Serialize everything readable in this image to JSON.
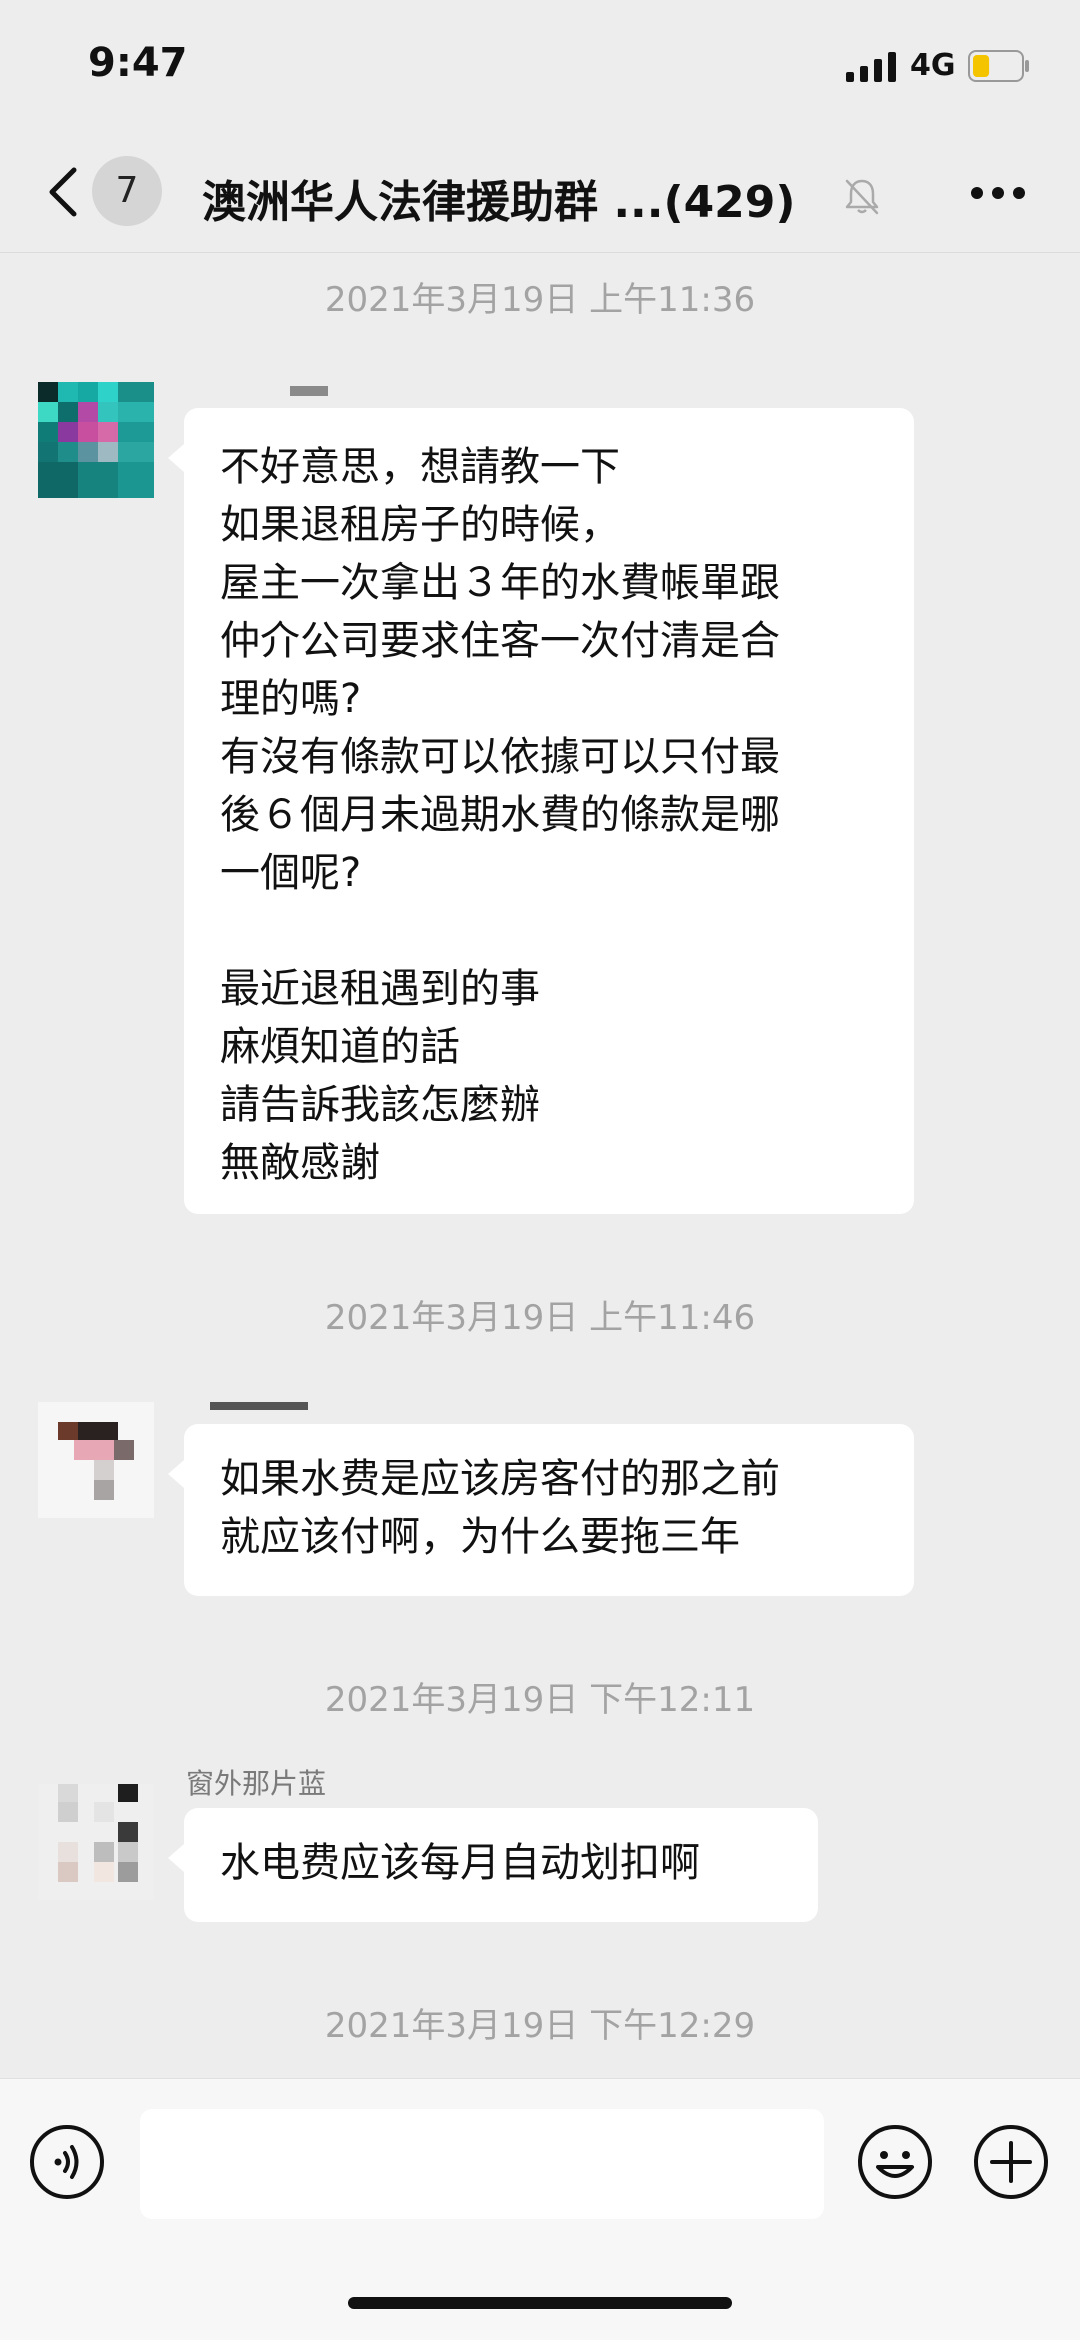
{
  "status_bar": {
    "time": "9:47",
    "network": "4G",
    "battery_level": 0.35,
    "battery_color": "#f5c400"
  },
  "nav": {
    "back_icon": "chevron-left-icon",
    "unread_count": "7",
    "title": "澳洲华人法律援助群 ...(429)",
    "mute_icon": "bell-slash-icon",
    "more_icon": "more-dots-icon"
  },
  "messages": {
    "ts1": "2021年3月19日 上午11:36",
    "msg1": {
      "lines": [
        "不好意思，想請教一下",
        "如果退租房子的時候，",
        "屋主一次拿出３年的水費帳單跟",
        "仲介公司要求住客一次付清是合",
        "理的嗎?",
        "有沒有條款可以依據可以只付最",
        "後６個月未過期水費的條款是哪",
        "一個呢?",
        "",
        "最近退租遇到的事",
        "麻煩知道的話",
        "請告訴我該怎麼辦",
        "無敵感謝"
      ]
    },
    "ts2": "2021年3月19日 上午11:46",
    "msg2": {
      "lines": [
        "如果水费是应该房客付的那之前",
        "就应该付啊，为什么要拖三年"
      ]
    },
    "ts3": "2021年3月19日 下午12:11",
    "msg3": {
      "sender": "窗外那片蓝",
      "lines": [
        "水电费应该每月自动划扣啊"
      ]
    },
    "ts4": "2021年3月19日 下午12:29"
  },
  "input_bar": {
    "voice_icon": "voice-input-icon",
    "input_value": "",
    "emoji_icon": "emoji-smile-icon",
    "plus_icon": "plus-circle-icon"
  },
  "colors": {
    "background": "#ededed",
    "bubble": "#ffffff",
    "timestamp": "#a3a3a3"
  }
}
